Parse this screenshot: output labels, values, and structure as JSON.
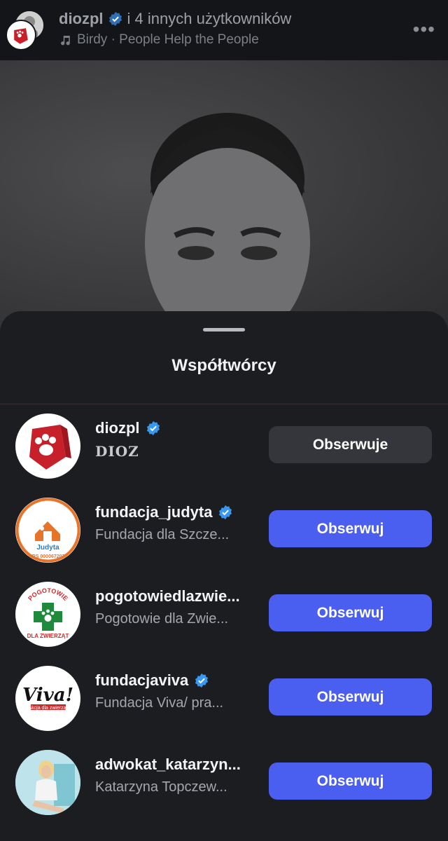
{
  "header": {
    "username": "diozpl",
    "rest": "i 4 innych użytkowników",
    "song": "Birdy · People Help the People",
    "more_icon": "more-icon"
  },
  "sheet": {
    "title": "Współtwórcy",
    "collaborators": [
      {
        "username": "diozpl",
        "fullname": "DIOZ",
        "verified": true,
        "button": "Obserwuje",
        "following": true
      },
      {
        "username": "fundacja_judyta",
        "fullname": "Fundacja dla Szcze...",
        "verified": true,
        "button": "Obserwuj",
        "following": false
      },
      {
        "username": "pogotowiedlazwie...",
        "fullname": "Pogotowie dla Zwie...",
        "verified": false,
        "button": "Obserwuj",
        "following": false
      },
      {
        "username": "fundacjaviva",
        "fullname": "Fundacja Viva/ pra...",
        "verified": true,
        "button": "Obserwuj",
        "following": false
      },
      {
        "username": "adwokat_katarzyn...",
        "fullname": "Katarzyna Topczew...",
        "verified": false,
        "button": "Obserwuj",
        "following": false
      }
    ],
    "avatar_texts": {
      "judyta_name": "Judyta",
      "judyta_krs": "KRS 0000672078",
      "pogotowie_top": "POGOTOWIE",
      "pogotowie_bottom": "DLA ZWIERZĄT",
      "viva_logo": "Viva!",
      "viva_sub": "Akcja dla zwierząt"
    }
  },
  "colors": {
    "accent": "#4a5ef0",
    "verified": "#3897f0",
    "dioz_red": "#c8202a"
  }
}
